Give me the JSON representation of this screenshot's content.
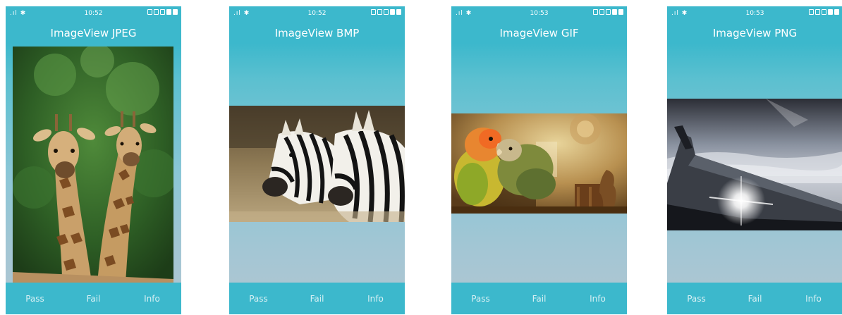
{
  "screens": [
    {
      "status": {
        "time": "10:52",
        "left_icons": ".ıl ✱"
      },
      "title": "ImageView JPEG",
      "image": "giraffes-photo",
      "buttons": {
        "pass": "Pass",
        "fail": "Fail",
        "info": "Info"
      }
    },
    {
      "status": {
        "time": "10:52",
        "left_icons": ".ıl ✱"
      },
      "title": "ImageView BMP",
      "image": "zebras-photo",
      "buttons": {
        "pass": "Pass",
        "fail": "Fail",
        "info": "Info"
      }
    },
    {
      "status": {
        "time": "10:53",
        "left_icons": ".ıl ✱"
      },
      "title": "ImageView GIF",
      "image": "parrots-photo",
      "buttons": {
        "pass": "Pass",
        "fail": "Fail",
        "info": "Info"
      }
    },
    {
      "status": {
        "time": "10:53",
        "left_icons": ".ıl ✱"
      },
      "title": "ImageView PNG",
      "image": "airplane-wing-photo",
      "buttons": {
        "pass": "Pass",
        "fail": "Fail",
        "info": "Info"
      }
    }
  ]
}
